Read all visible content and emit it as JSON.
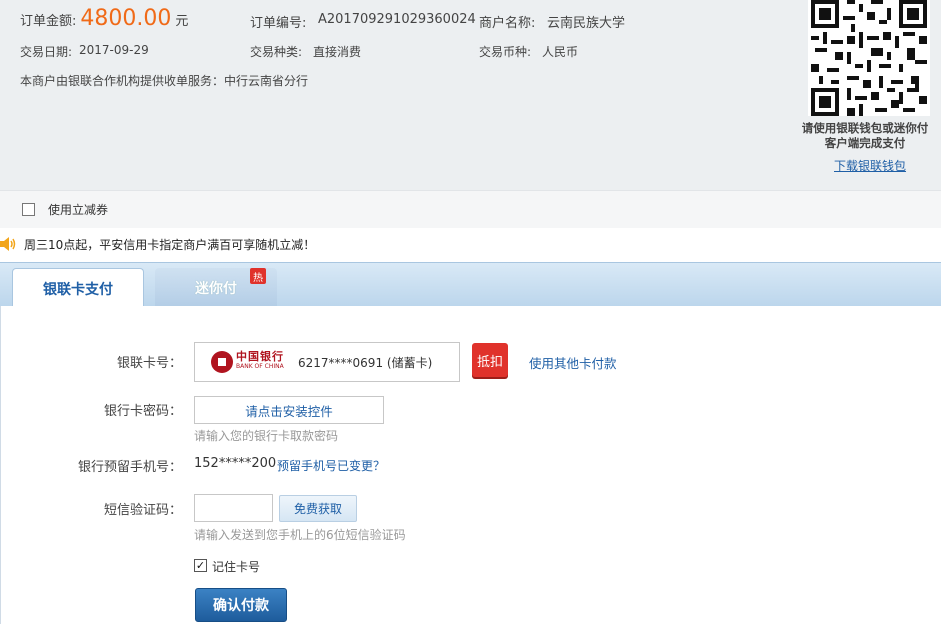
{
  "order": {
    "amount_label": "订单金额:",
    "amount": "4800.00",
    "currency_unit": "元",
    "number_label": "订单编号:",
    "number": "A201709291029360024",
    "merchant_label": "商户名称:",
    "merchant": "云南民族大学",
    "date_label": "交易日期:",
    "date": "2017-09-29",
    "type_label": "交易种类:",
    "type": "直接消费",
    "currency_label": "交易币种:",
    "currency": "人民币",
    "service_note": "本商户由银联合作机构提供收单服务：中行云南省分行"
  },
  "qr": {
    "caption": "请使用银联钱包或迷你付客户端完成支付",
    "download_link": "下载银联钱包"
  },
  "coupon": {
    "label": "使用立减券"
  },
  "promo": {
    "text": "周三10点起，平安信用卡指定商户满百可享随机立减！"
  },
  "tabs": {
    "active": "银联卡支付",
    "inactive": "迷你付",
    "hot_badge": "热"
  },
  "form": {
    "card_label": "银联卡号：",
    "bank_name_cn": "中国银行",
    "bank_name_en": "BANK OF CHINA",
    "card_number": "6217****0691 (储蓄卡)",
    "deduct_badge": "抵扣",
    "other_card_link": "使用其他卡付款",
    "password_label": "银行卡密码：",
    "install_button": "请点击安装控件",
    "password_hint": "请输入您的银行卡取款密码",
    "phone_label": "银行预留手机号：",
    "phone": "152*****200",
    "phone_changed_link": "预留手机号已变更？",
    "sms_label": "短信验证码：",
    "sms_button": "免费获取",
    "sms_hint": "请输入发送到您手机上的6位短信验证码",
    "remember_label": "记住卡号",
    "remember_checked": true,
    "confirm_button": "确认付款"
  }
}
